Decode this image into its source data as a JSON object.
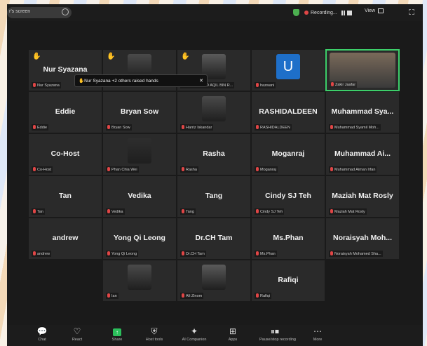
{
  "topbar": {
    "share_label": "r's screen",
    "recording_label": "Recording...",
    "view_label": "View"
  },
  "tooltip": {
    "text": "Nur Syazana +2 others raised hands",
    "close": "✕"
  },
  "tiles": [
    {
      "name": "Nur Syazana",
      "label": "Nur Syazana",
      "hand": true
    },
    {
      "name": "",
      "label": "",
      "hand": true,
      "photo": true
    },
    {
      "name": "",
      "label": "MUHAMMAD AQIL BIN R...",
      "hand": true,
      "photo": true
    },
    {
      "name": "",
      "label": "hazwani",
      "avatar": "U"
    },
    {
      "name": "",
      "label": "Zakir Jaafar",
      "photo": true,
      "active": true
    },
    {
      "name": "Eddie",
      "label": "Eddie"
    },
    {
      "name": "Bryan Sow",
      "label": "Bryan Sow"
    },
    {
      "name": "",
      "label": "Harriz Iskandar",
      "photo": true
    },
    {
      "name": "RASHIDALDEEN",
      "label": "RASHIDALDEEN"
    },
    {
      "name": "Muhammad Sya...",
      "label": "Muhammad Syamil Moh..."
    },
    {
      "name": "Co-Host",
      "label": "Co-Host"
    },
    {
      "name": "",
      "label": "Phan Chia Wei",
      "photo": true
    },
    {
      "name": "Rasha",
      "label": "Rasha"
    },
    {
      "name": "Moganraj",
      "label": "Moganraj"
    },
    {
      "name": "Muhammad Ai...",
      "label": "Muhammad Aiman Irfan"
    },
    {
      "name": "Tan",
      "label": "Tan"
    },
    {
      "name": "Vedika",
      "label": "Vedika"
    },
    {
      "name": "Tang",
      "label": "Tang"
    },
    {
      "name": "Cindy SJ Teh",
      "label": "Cindy SJ Teh"
    },
    {
      "name": "Maziah Mat Rosly",
      "label": "Maziah Mat Rosly"
    },
    {
      "name": "andrew",
      "label": "andrew"
    },
    {
      "name": "Yong Qi Leong",
      "label": "Yong Qi Leong"
    },
    {
      "name": "Dr.CH Tam",
      "label": "Dr.CH Tam"
    },
    {
      "name": "Ms.Phan",
      "label": "Ms.Phan"
    },
    {
      "name": "Noraisyah Moh...",
      "label": "Noraisyah Mohamed Sha..."
    },
    {
      "name": "",
      "label": "Ian",
      "photo": true
    },
    {
      "name": "",
      "label": "Afi Zinom",
      "photo": true
    },
    {
      "name": "Rafiqi",
      "label": "Rafiqi"
    }
  ],
  "controls": [
    {
      "icon": "chat-icon",
      "glyph": "💬",
      "label": "Chat"
    },
    {
      "icon": "react-icon",
      "glyph": "♡",
      "label": "React"
    },
    {
      "icon": "share-icon",
      "glyph": "↑",
      "label": "Share"
    },
    {
      "icon": "host-tools-icon",
      "glyph": "⛨",
      "label": "Host tools"
    },
    {
      "icon": "ai-companion-icon",
      "glyph": "✦",
      "label": "AI Companion"
    },
    {
      "icon": "apps-icon",
      "glyph": "⊞",
      "label": "Apps"
    },
    {
      "icon": "pause-stop-recording-icon",
      "glyph": "⏸⏹",
      "label": "Pause/stop recording"
    },
    {
      "icon": "more-icon",
      "glyph": "⋯",
      "label": "More"
    }
  ]
}
